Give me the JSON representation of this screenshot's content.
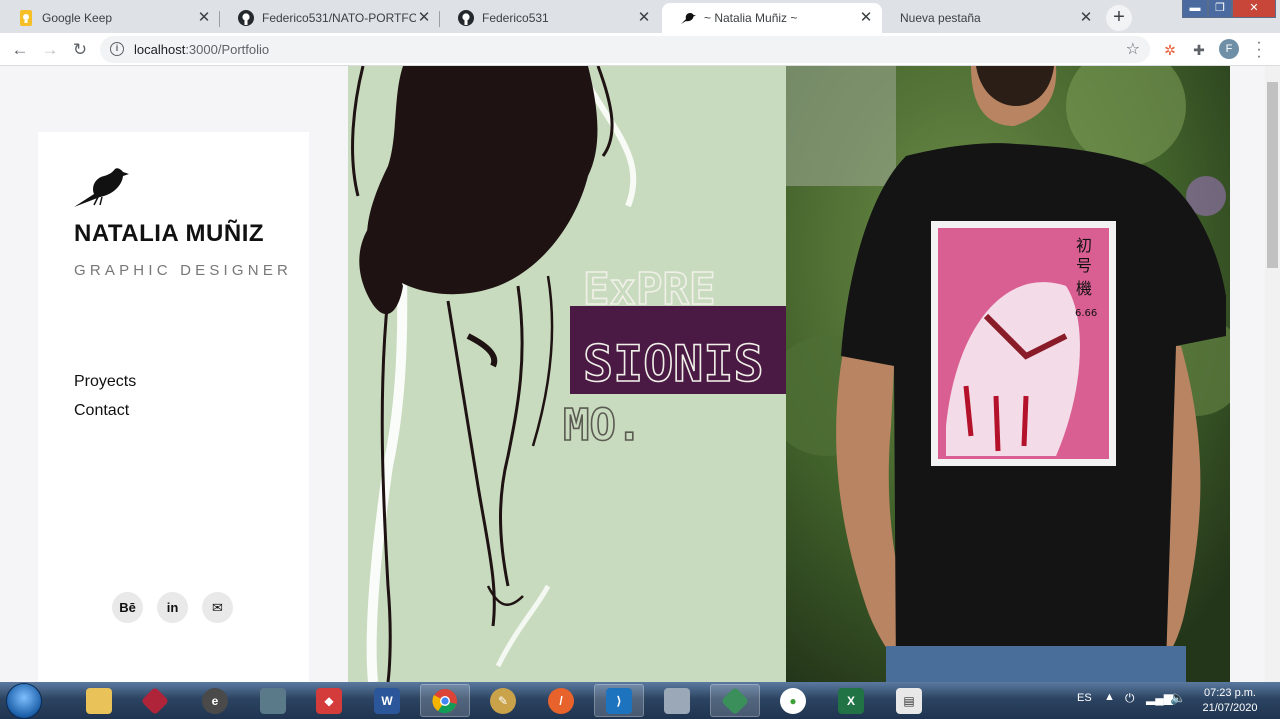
{
  "browser": {
    "tabs": [
      {
        "title": "Google Keep",
        "icon": "google-keep-icon",
        "active": false
      },
      {
        "title": "Federico531/NATO-PORTFOLIO",
        "icon": "github-icon",
        "active": false
      },
      {
        "title": "Federico531",
        "icon": "github-icon",
        "active": false
      },
      {
        "title": "~ Natalia Muñiz ~",
        "icon": "bird-icon",
        "active": true
      },
      {
        "title": "Nueva pestaña",
        "icon": "",
        "active": false
      }
    ],
    "url_host": "localhost",
    "url_path": ":3000/Portfolio",
    "profile_initial": "F"
  },
  "site": {
    "brand_name": "NATALIA MUÑIZ",
    "brand_role": "GRAPHIC DESIGNER",
    "nav": [
      "Proyects",
      "Contact"
    ],
    "social": [
      {
        "label": "Bē",
        "icon": "behance-icon"
      },
      {
        "label": "in",
        "icon": "linkedin-icon"
      },
      {
        "label": "✉",
        "icon": "mail-icon"
      }
    ],
    "poster_text": [
      "ExPRE",
      "SIONIS",
      "MO."
    ],
    "shirt_text": [
      "初",
      "号",
      "機",
      "6.66"
    ]
  },
  "taskbar": {
    "language": "ES",
    "time": "07:23 p.m.",
    "date": "21/07/2020"
  }
}
